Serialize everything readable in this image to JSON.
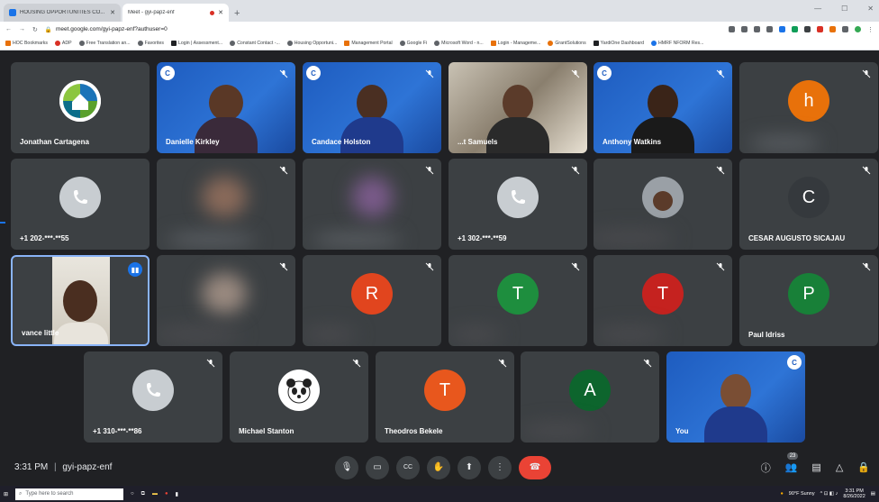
{
  "browser": {
    "tabs": [
      {
        "title": "HOUSING OPPORTUNITIES CO...",
        "active": false
      },
      {
        "title": "Meet - gyi-papz-enf",
        "active": true
      }
    ],
    "new_tab": "+",
    "url": "meet.google.com/gyi-papz-enf?authuser=0",
    "bookmarks": [
      "HOC Bookmarks",
      "ADP",
      "Free Translation an...",
      "Favorites",
      "Login | Assessment...",
      "Constant Contact -...",
      "Housing Opportuni...",
      "Management Portal",
      "Google Fi",
      "Microsoft Word - n...",
      "Login - Manageme...",
      "GrantSolutions",
      "YardiOne Dashboard",
      "HMRF NFORM Res..."
    ]
  },
  "participants": [
    {
      "name": "Jonathan Cartagena",
      "type": "logo"
    },
    {
      "name": "Danielle Kirkley",
      "type": "video"
    },
    {
      "name": "Candace Holston",
      "type": "video"
    },
    {
      "name": "...t Samuels",
      "type": "video"
    },
    {
      "name": "Anthony Watkins",
      "type": "video"
    },
    {
      "name": "",
      "type": "avatar",
      "letter": "h",
      "color": "#e8710a"
    },
    {
      "name": "+1 202-***-**55",
      "type": "phone"
    },
    {
      "name": "",
      "type": "blurred"
    },
    {
      "name": "",
      "type": "blurred"
    },
    {
      "name": "+1 302-***-**59",
      "type": "phone"
    },
    {
      "name": "",
      "type": "photo"
    },
    {
      "name": "CESAR AUGUSTO SICAJAU",
      "type": "avatar",
      "letter": "C",
      "color": "#3c4043"
    },
    {
      "name": "vance little",
      "type": "video"
    },
    {
      "name": "",
      "type": "blurred"
    },
    {
      "name": "",
      "type": "avatar",
      "letter": "R",
      "color": "#d93025"
    },
    {
      "name": "",
      "type": "avatar",
      "letter": "T",
      "color": "#1e8e3e"
    },
    {
      "name": "",
      "type": "avatar",
      "letter": "T",
      "color": "#c5221f"
    },
    {
      "name": "Paul Idriss",
      "type": "avatar",
      "letter": "P",
      "color": "#188038"
    },
    {
      "name": "+1 310-***-**86",
      "type": "phone"
    },
    {
      "name": "Michael Stanton",
      "type": "photo"
    },
    {
      "name": "Theodros Bekele",
      "type": "avatar",
      "letter": "T",
      "color": "#e8571d"
    },
    {
      "name": "",
      "type": "avatar",
      "letter": "A",
      "color": "#0d652d"
    },
    {
      "name": "You",
      "type": "video"
    }
  ],
  "controls": {
    "time": "3:31 PM",
    "meeting_code": "gyi-papz-enf",
    "people_count": "23"
  },
  "taskbar": {
    "search_placeholder": "Type here to search",
    "weather": "90°F Sunny",
    "clock_time": "3:31 PM",
    "clock_date": "8/26/2022"
  }
}
